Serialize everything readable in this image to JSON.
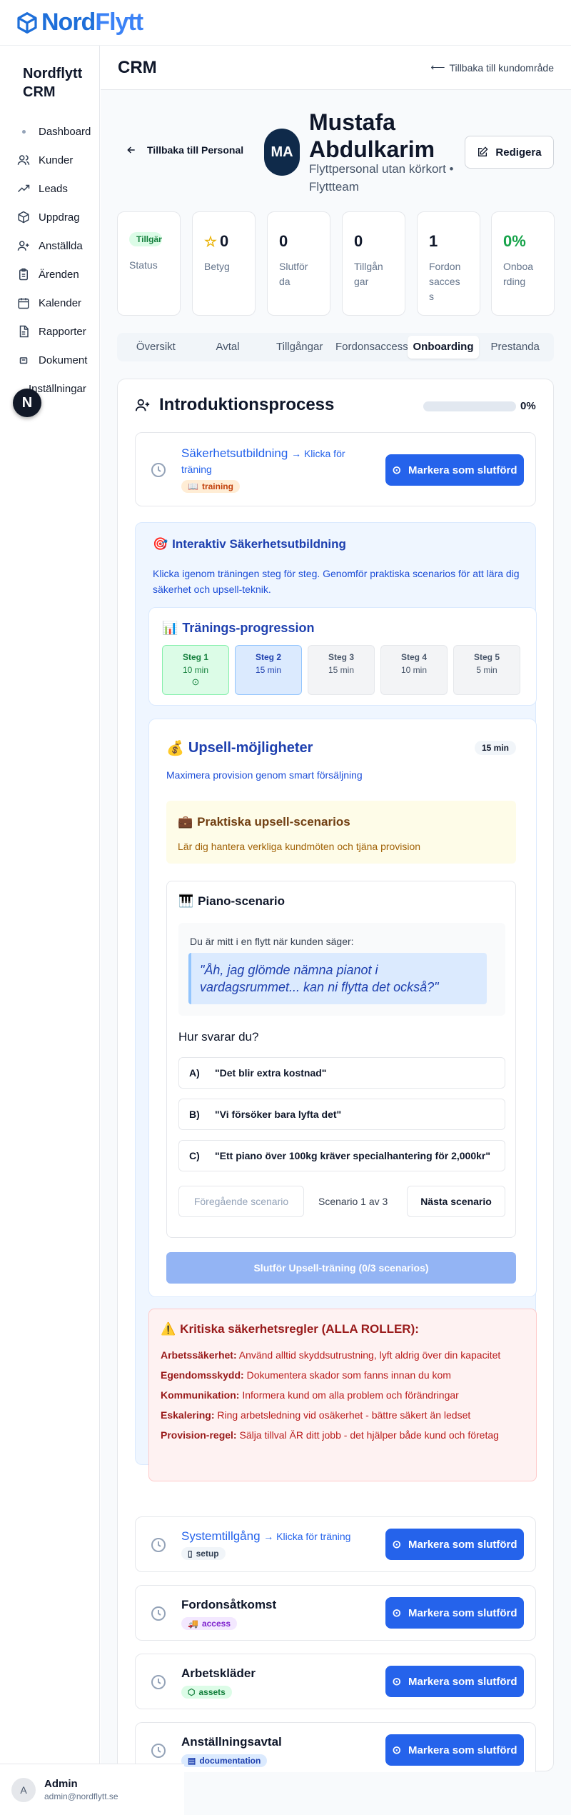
{
  "brand": {
    "nord": "Nord",
    "flytt": "Flytt"
  },
  "sidebar": {
    "title": "Nordflytt CRM",
    "items": [
      {
        "label": "Dashboard",
        "icon": "dot-icon"
      },
      {
        "label": "Kunder",
        "icon": "users-icon"
      },
      {
        "label": "Leads",
        "icon": "trending-up-icon"
      },
      {
        "label": "Uppdrag",
        "icon": "package-icon"
      },
      {
        "label": "Anställda",
        "icon": "user-plus-icon"
      },
      {
        "label": "Ärenden",
        "icon": "clipboard-icon"
      },
      {
        "label": "Kalender",
        "icon": "calendar-icon"
      },
      {
        "label": "Rapporter",
        "icon": "file-icon"
      },
      {
        "label": "Dokument",
        "icon": "document-icon"
      },
      {
        "label": "Inställningar",
        "icon": "settings-icon"
      }
    ],
    "badge": "N",
    "user": {
      "initial": "A",
      "name": "Admin",
      "email": "admin@nordflytt.se"
    }
  },
  "header": {
    "title": "CRM",
    "back_link": "Tillbaka till kundområde"
  },
  "profile": {
    "back_label": "Tillbaka till Personal",
    "initials": "MA",
    "name": "Mustafa Abdulkarim",
    "role": "Flyttpersonal utan körkort • Flyttteam",
    "edit_label": "Redigera"
  },
  "stats": [
    {
      "value": "Tillgänglig",
      "label": "Status",
      "type": "status"
    },
    {
      "value": "0",
      "label": "Betyg",
      "type": "star"
    },
    {
      "value": "0",
      "label": "Slutförda",
      "type": "num"
    },
    {
      "value": "0",
      "label": "Tillgångar",
      "type": "num"
    },
    {
      "value": "1",
      "label": "Fordonsaccess",
      "type": "num"
    },
    {
      "value": "0%",
      "label": "Onboarding",
      "type": "pct"
    }
  ],
  "tabs": [
    "Översikt",
    "Avtal",
    "Tillgångar",
    "Fordonsaccess",
    "Onboarding",
    "Prestanda"
  ],
  "active_tab": "Onboarding",
  "onboarding": {
    "title": "Introduktionsprocess",
    "progress": 0,
    "progress_label": "0%",
    "mark_label": "Markera som slutförd",
    "steps": [
      {
        "title": "Säkerhetsutbildning",
        "link": "→ Klicka för träning",
        "tag": "training"
      },
      {
        "title": "Systemtillgång",
        "link": "→ Klicka för träning",
        "tag": "setup"
      },
      {
        "title": "Fordonsåtkomst",
        "link": "",
        "tag": "access"
      },
      {
        "title": "Arbetskläder",
        "link": "",
        "tag": "assets"
      },
      {
        "title": "Anställningsavtal",
        "link": "",
        "tag": "documentation"
      }
    ],
    "training": {
      "title": "Interaktiv Säkerhetsutbildning",
      "desc": "Klicka igenom träningen steg för steg. Genomför praktiska scenarios för att lära dig säkerhet och upsell-teknik.",
      "progress_title": "Tränings-progression",
      "steps": [
        {
          "label": "Steg 1",
          "minutes": "10 min",
          "state": "done"
        },
        {
          "label": "Steg 2",
          "minutes": "15 min",
          "state": "active"
        },
        {
          "label": "Steg 3",
          "minutes": "15 min",
          "state": "todo"
        },
        {
          "label": "Steg 4",
          "minutes": "10 min",
          "state": "todo"
        },
        {
          "label": "Steg 5",
          "minutes": "5 min",
          "state": "todo"
        }
      ],
      "upsell": {
        "title": "Upsell-möjligheter",
        "minutes": "15 min",
        "desc": "Maximera provision genom smart försäljning",
        "practical_title": "Praktiska upsell-scenarios",
        "practical_desc": "Lär dig hantera verkliga kundmöten och tjäna provision",
        "scenario_title": "Piano-scenario",
        "scenario_intro": "Du är mitt i en flytt när kunden säger:",
        "quote": "\"Åh, jag glömde nämna pianot i vardagsrummet... kan ni flytta det också?\"",
        "question": "Hur svarar du?",
        "answers": [
          {
            "letter": "A)",
            "text": "\"Det blir extra kostnad\""
          },
          {
            "letter": "B)",
            "text": "\"Vi försöker bara lyfta det\""
          },
          {
            "letter": "C)",
            "text": "\"Ett piano över 100kg kräver specialhantering för 2,000kr\""
          }
        ],
        "prev_label": "Föregående scenario",
        "page_label": "Scenario 1 av 3",
        "next_label": "Nästa scenario",
        "finish_label": "Slutför Upsell-träning (0/3 scenarios)"
      },
      "safety": {
        "title": "Kritiska säkerhetsregler (ALLA ROLLER):",
        "rules": [
          {
            "key": "Arbetssäkerhet:",
            "text": " Använd alltid skyddsutrustning, lyft aldrig över din kapacitet"
          },
          {
            "key": "Egendomsskydd:",
            "text": " Dokumentera skador som fanns innan du kom"
          },
          {
            "key": "Kommunikation:",
            "text": " Informera kund om alla problem och förändringar"
          },
          {
            "key": "Eskalering:",
            "text": " Ring arbetsledning vid osäkerhet - bättre säkert än ledset"
          },
          {
            "key": "Provision-regel:",
            "text": " Sälja tillval ÄR ditt jobb - det hjälper både kund och företag"
          }
        ]
      }
    }
  },
  "colors": {
    "primary": "#2563eb",
    "navy": "#0f2a4a",
    "success": "#16a34a"
  }
}
